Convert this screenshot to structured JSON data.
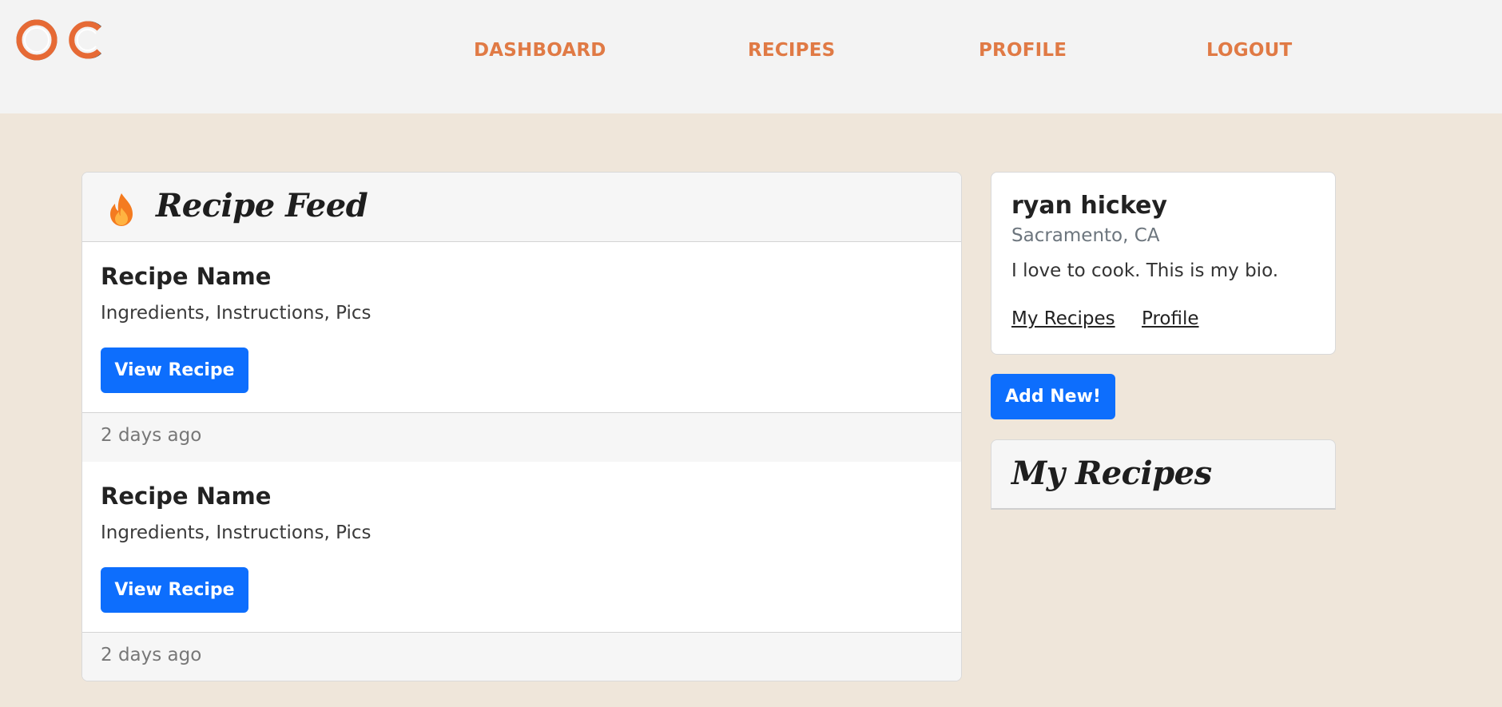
{
  "nav": {
    "logo_text": "OC",
    "links": [
      "DASHBOARD",
      "RECIPES",
      "PROFILE",
      "LOGOUT"
    ]
  },
  "feed": {
    "title": "Recipe Feed",
    "icon": "flame-icon",
    "recipes": [
      {
        "name": "Recipe Name",
        "description": "Ingredients, Instructions, Pics",
        "button": "View Recipe",
        "time": "2 days ago"
      },
      {
        "name": "Recipe Name",
        "description": "Ingredients, Instructions, Pics",
        "button": "View Recipe",
        "time": "2 days ago"
      }
    ]
  },
  "profile": {
    "name": "ryan hickey",
    "location": "Sacramento, CA",
    "bio": "I love to cook. This is my bio.",
    "links": [
      "My Recipes ",
      "Profile"
    ]
  },
  "add_new_label": "Add New!",
  "my_recipes": {
    "title": "My Recipes"
  },
  "colors": {
    "accent": "#e07a45",
    "primary_button": "#0d6efd",
    "page_background": "#efe6da",
    "header_background": "#f3f3f3"
  }
}
